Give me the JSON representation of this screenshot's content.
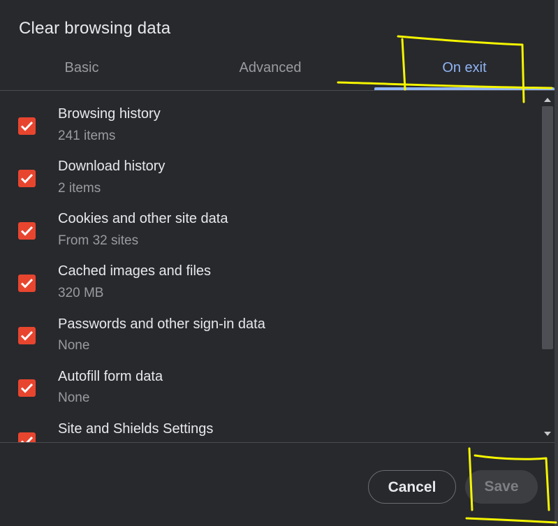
{
  "dialog": {
    "title": "Clear browsing data",
    "tabs": [
      {
        "label": "Basic",
        "active": false
      },
      {
        "label": "Advanced",
        "active": false
      },
      {
        "label": "On exit",
        "active": true
      }
    ],
    "items": [
      {
        "label": "Browsing history",
        "sub": "241 items",
        "checked": true
      },
      {
        "label": "Download history",
        "sub": "2 items",
        "checked": true
      },
      {
        "label": "Cookies and other site data",
        "sub": "From 32 sites",
        "checked": true
      },
      {
        "label": "Cached images and files",
        "sub": "320 MB",
        "checked": true
      },
      {
        "label": "Passwords and other sign-in data",
        "sub": "None",
        "checked": true
      },
      {
        "label": "Autofill form data",
        "sub": "None",
        "checked": true
      },
      {
        "label": "Site and Shields Settings",
        "sub": "",
        "checked": true
      }
    ],
    "buttons": {
      "cancel": "Cancel",
      "save": "Save"
    }
  },
  "colors": {
    "background": "#28292d",
    "accent": "#8fb4f5",
    "checkbox": "#e8452f",
    "annotation": "#f5f500"
  },
  "annotations": [
    "highlight-on-exit-tab",
    "highlight-save-button"
  ]
}
